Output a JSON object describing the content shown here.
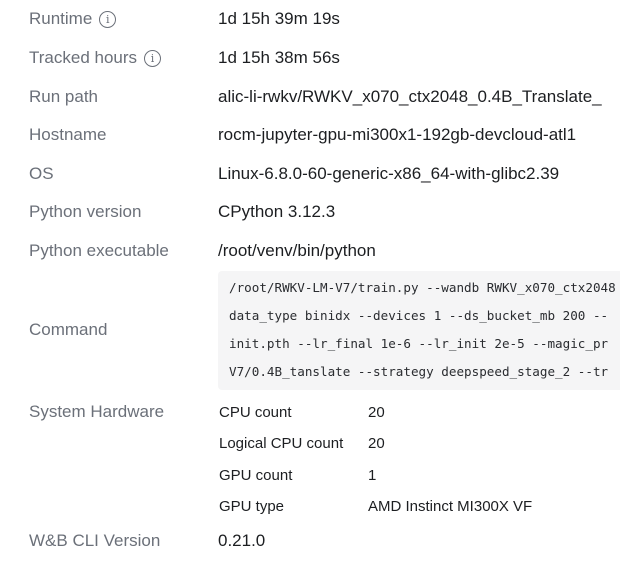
{
  "rows": [
    {
      "label": "Runtime",
      "value": "1d 15h 39m 19s",
      "info": true
    },
    {
      "label": "Tracked hours",
      "value": "1d 15h 38m 56s",
      "info": true
    },
    {
      "label": "Run path",
      "value": "alic-li-rwkv/RWKV_x070_ctx2048_0.4B_Translate_"
    },
    {
      "label": "Hostname",
      "value": "rocm-jupyter-gpu-mi300x1-192gb-devcloud-atl1"
    },
    {
      "label": "OS",
      "value": "Linux-6.8.0-60-generic-x86_64-with-glibc2.39"
    },
    {
      "label": "Python version",
      "value": "CPython 3.12.3"
    },
    {
      "label": "Python executable",
      "value": "/root/venv/bin/python"
    }
  ],
  "command": {
    "label": "Command",
    "lines": [
      "/root/RWKV-LM-V7/train.py --wandb RWKV_x070_ctx2048",
      "data_type binidx --devices 1 --ds_bucket_mb 200 --",
      "init.pth --lr_final 1e-6 --lr_init 2e-5 --magic_pr",
      "V7/0.4B_tanslate --strategy deepspeed_stage_2 --tr"
    ]
  },
  "hardware": {
    "label": "System Hardware",
    "items": [
      {
        "key": "CPU count",
        "value": "20"
      },
      {
        "key": "Logical CPU count",
        "value": "20"
      },
      {
        "key": "GPU count",
        "value": "1"
      },
      {
        "key": "GPU type",
        "value": "AMD Instinct MI300X VF"
      }
    ]
  },
  "cli": {
    "label": "W&B CLI Version",
    "value": "0.21.0"
  },
  "info_glyph": "i"
}
